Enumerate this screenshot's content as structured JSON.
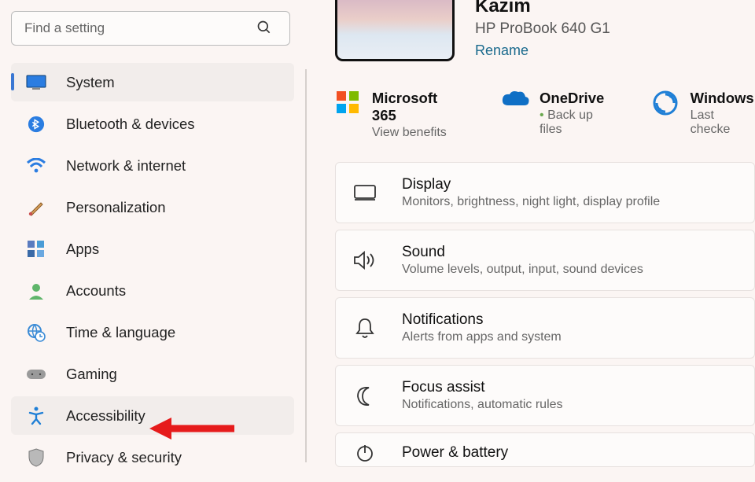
{
  "search": {
    "placeholder": "Find a setting"
  },
  "nav": [
    {
      "label": "System",
      "active": true,
      "icon": "monitor"
    },
    {
      "label": "Bluetooth & devices",
      "active": false,
      "icon": "bluetooth"
    },
    {
      "label": "Network & internet",
      "active": false,
      "icon": "wifi"
    },
    {
      "label": "Personalization",
      "active": false,
      "icon": "brush"
    },
    {
      "label": "Apps",
      "active": false,
      "icon": "apps"
    },
    {
      "label": "Accounts",
      "active": false,
      "icon": "person"
    },
    {
      "label": "Time & language",
      "active": false,
      "icon": "globe-clock"
    },
    {
      "label": "Gaming",
      "active": false,
      "icon": "gamepad"
    },
    {
      "label": "Accessibility",
      "active": false,
      "icon": "accessibility",
      "hover": true
    },
    {
      "label": "Privacy & security",
      "active": false,
      "icon": "shield"
    }
  ],
  "profile": {
    "name": "Kazim",
    "device": "HP ProBook 640 G1",
    "rename": "Rename"
  },
  "services": [
    {
      "title": "Microsoft 365",
      "sub": "View benefits",
      "icon": "ms365"
    },
    {
      "title": "OneDrive",
      "sub": "Back up files",
      "icon": "onedrive",
      "bullet": true
    },
    {
      "title": "Windows",
      "sub": "Last checke",
      "icon": "update"
    }
  ],
  "cards": [
    {
      "title": "Display",
      "sub": "Monitors, brightness, night light, display profile",
      "icon": "display"
    },
    {
      "title": "Sound",
      "sub": "Volume levels, output, input, sound devices",
      "icon": "sound"
    },
    {
      "title": "Notifications",
      "sub": "Alerts from apps and system",
      "icon": "bell"
    },
    {
      "title": "Focus assist",
      "sub": "Notifications, automatic rules",
      "icon": "moon"
    },
    {
      "title": "Power & battery",
      "sub": "",
      "icon": "power"
    }
  ]
}
